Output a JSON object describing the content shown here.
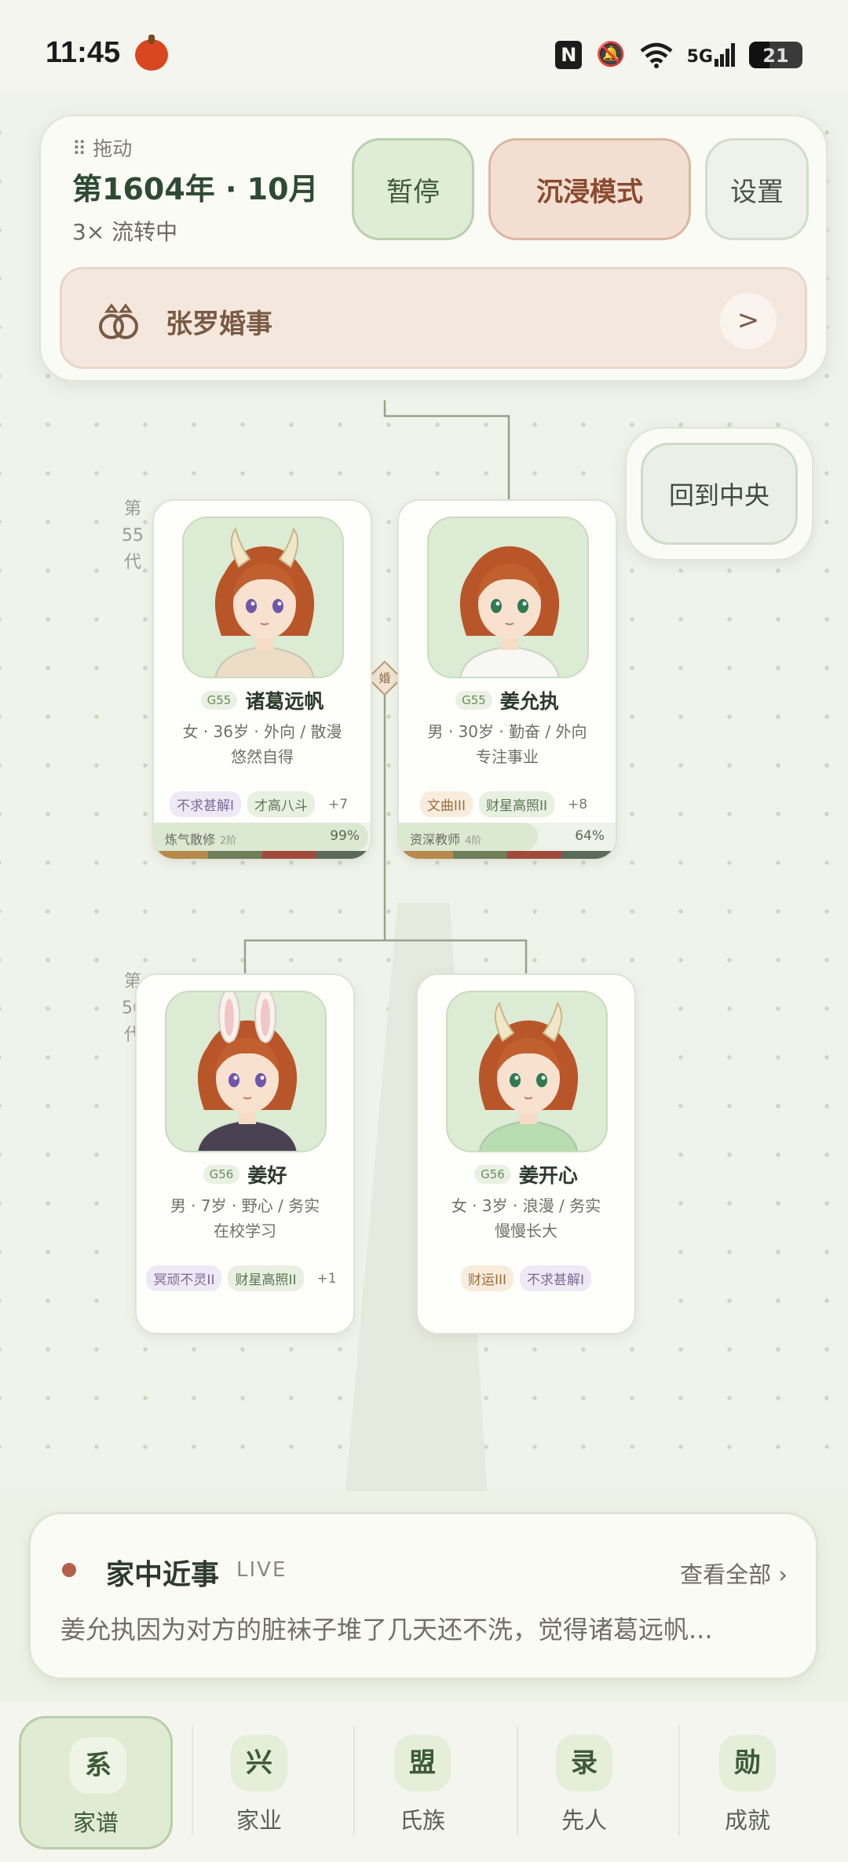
{
  "status_bar": {
    "time": "11:45",
    "battery": "21",
    "network": "5G"
  },
  "header": {
    "drag_label": "⠿ 拖动",
    "date": "第1604年 · 10月",
    "speed": "3× 流转中",
    "pause_label": "暂停",
    "immerse_label": "沉浸模式",
    "settings_label": "设置",
    "event_title": "张罗婚事",
    "event_arrow": ">"
  },
  "recenter_label": "回到中央",
  "generations": [
    {
      "label": "第55代"
    },
    {
      "label": "第56代"
    }
  ],
  "marriage_badge": "婚",
  "members": [
    {
      "gen_tag": "G55",
      "name": "诸葛远帆",
      "attrs": "女 · 36岁 · 外向 / 散漫",
      "status": "悠然自得",
      "tags": [
        {
          "text": "不求甚解I",
          "kind": "purple"
        },
        {
          "text": "才高八斗",
          "kind": "green"
        }
      ],
      "more": "+7",
      "skill": "炼气散修",
      "level": "2阶",
      "progress_label": "99%",
      "progress": 0.99,
      "ears": "horns",
      "eye": "#6e56a8",
      "outfit": "#ecdcc6"
    },
    {
      "gen_tag": "G55",
      "name": "姜允执",
      "attrs": "男 · 30岁 · 勤奋 / 外向",
      "status": "专注事业",
      "tags": [
        {
          "text": "文曲III",
          "kind": "orange"
        },
        {
          "text": "财星高照II",
          "kind": "green"
        }
      ],
      "more": "+8",
      "skill": "资深教师",
      "level": "4阶",
      "progress_label": "64%",
      "progress": 0.64,
      "ears": "none",
      "eye": "#2f7a52",
      "outfit": "#f7f7f4"
    },
    {
      "gen_tag": "G56",
      "name": "姜好",
      "attrs": "男 · 7岁 · 野心 / 务实",
      "status": "在校学习",
      "tags": [
        {
          "text": "冥顽不灵II",
          "kind": "purple"
        },
        {
          "text": "财星高照II",
          "kind": "green"
        }
      ],
      "more": "+1",
      "ears": "rabbit",
      "eye": "#6e56a8",
      "outfit": "#4a4252"
    },
    {
      "gen_tag": "G56",
      "name": "姜开心",
      "attrs": "女 · 3岁 · 浪漫 / 务实",
      "status": "慢慢长大",
      "tags": [
        {
          "text": "财运III",
          "kind": "orange"
        },
        {
          "text": "不求甚解I",
          "kind": "purple"
        }
      ],
      "more": "",
      "ears": "horns",
      "eye": "#2f7a52",
      "outfit": "#b6dcb0"
    }
  ],
  "news": {
    "title": "家中近事",
    "live": "LIVE",
    "view_all": "查看全部 ›",
    "text": "姜允执因为对方的脏袜子堆了几天还不洗，觉得诸葛远帆..."
  },
  "nav": [
    {
      "icon": "系",
      "label": "家谱",
      "active": true
    },
    {
      "icon": "兴",
      "label": "家业",
      "active": false
    },
    {
      "icon": "盟",
      "label": "氏族",
      "active": false
    },
    {
      "icon": "录",
      "label": "先人",
      "active": false
    },
    {
      "icon": "勋",
      "label": "成就",
      "active": false
    }
  ],
  "colors": {
    "accent_green": "#3e5a38",
    "event_brown": "#7a5a44",
    "live_dot": "#b5604a"
  }
}
